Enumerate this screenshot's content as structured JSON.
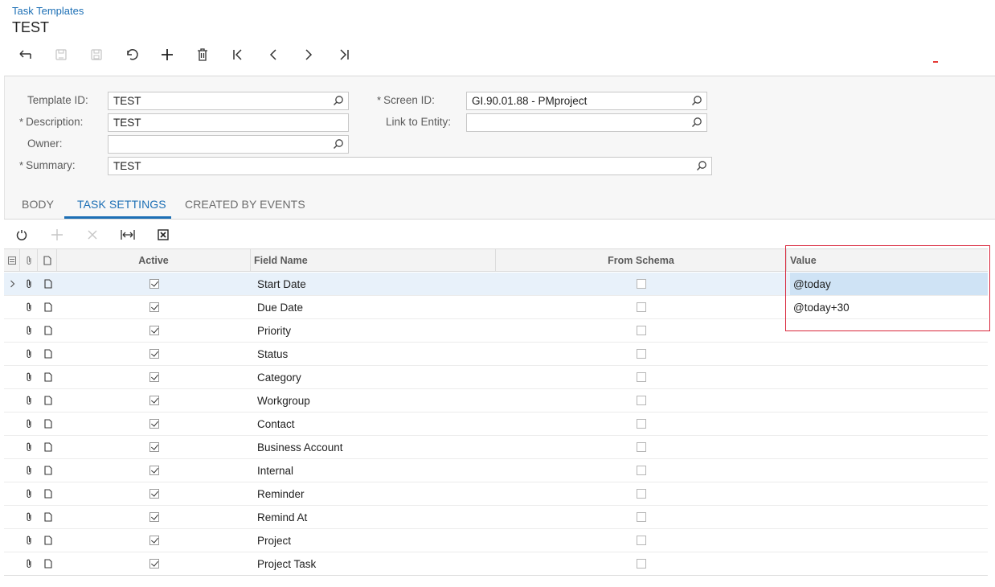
{
  "header": {
    "breadcrumb": "Task Templates",
    "title": "TEST"
  },
  "toolbar": {
    "buttons": [
      {
        "icon": "back-arrow-icon",
        "enabled": true
      },
      {
        "icon": "save-close-icon",
        "enabled": false
      },
      {
        "icon": "save-icon",
        "enabled": false
      },
      {
        "icon": "undo-icon",
        "enabled": true
      },
      {
        "icon": "plus-icon",
        "enabled": true
      },
      {
        "icon": "trash-icon",
        "enabled": true
      },
      {
        "icon": "first-record-icon",
        "enabled": true
      },
      {
        "icon": "previous-record-icon",
        "enabled": true
      },
      {
        "icon": "next-record-icon",
        "enabled": true
      },
      {
        "icon": "last-record-icon",
        "enabled": true
      }
    ]
  },
  "form": {
    "template_id": {
      "label": "Template ID:",
      "value": "TEST"
    },
    "description": {
      "label": "Description:",
      "value": "TEST",
      "required": "*"
    },
    "owner": {
      "label": "Owner:",
      "value": ""
    },
    "summary": {
      "label": "Summary:",
      "value": "TEST",
      "required": "*"
    },
    "screen_id": {
      "label": "Screen ID:",
      "value": "GI.90.01.88 - PMproject",
      "required": "*"
    },
    "link_to_entity": {
      "label": "Link to Entity:",
      "value": ""
    }
  },
  "tabs": [
    {
      "label": "BODY",
      "active": false
    },
    {
      "label": "TASK SETTINGS",
      "active": true
    },
    {
      "label": "CREATED BY EVENTS",
      "active": false
    }
  ],
  "grid": {
    "toolbar": [
      {
        "icon": "refresh-icon",
        "enabled": true
      },
      {
        "icon": "add-row-icon",
        "enabled": false
      },
      {
        "icon": "delete-row-icon",
        "enabled": false
      },
      {
        "icon": "fit-columns-icon",
        "enabled": true
      },
      {
        "icon": "export-excel-icon",
        "enabled": true
      }
    ],
    "columns": {
      "active": "Active",
      "field_name": "Field Name",
      "from_schema": "From Schema",
      "value": "Value"
    },
    "rows": [
      {
        "field": "Start Date",
        "active": true,
        "from_schema": false,
        "value": "@today"
      },
      {
        "field": "Due Date",
        "active": true,
        "from_schema": false,
        "value": "@today+30"
      },
      {
        "field": "Priority",
        "active": true,
        "from_schema": false,
        "value": ""
      },
      {
        "field": "Status",
        "active": true,
        "from_schema": false,
        "value": ""
      },
      {
        "field": "Category",
        "active": true,
        "from_schema": false,
        "value": ""
      },
      {
        "field": "Workgroup",
        "active": true,
        "from_schema": false,
        "value": ""
      },
      {
        "field": "Contact",
        "active": true,
        "from_schema": false,
        "value": ""
      },
      {
        "field": "Business Account",
        "active": true,
        "from_schema": false,
        "value": ""
      },
      {
        "field": "Internal",
        "active": true,
        "from_schema": false,
        "value": ""
      },
      {
        "field": "Reminder",
        "active": true,
        "from_schema": false,
        "value": ""
      },
      {
        "field": "Remind At",
        "active": true,
        "from_schema": false,
        "value": ""
      },
      {
        "field": "Project",
        "active": true,
        "from_schema": false,
        "value": ""
      },
      {
        "field": "Project Task",
        "active": true,
        "from_schema": false,
        "value": ""
      }
    ]
  },
  "colors": {
    "accent": "#1c6fb5",
    "highlight_border": "#d9263b",
    "selected_row": "#e8f1fa"
  }
}
